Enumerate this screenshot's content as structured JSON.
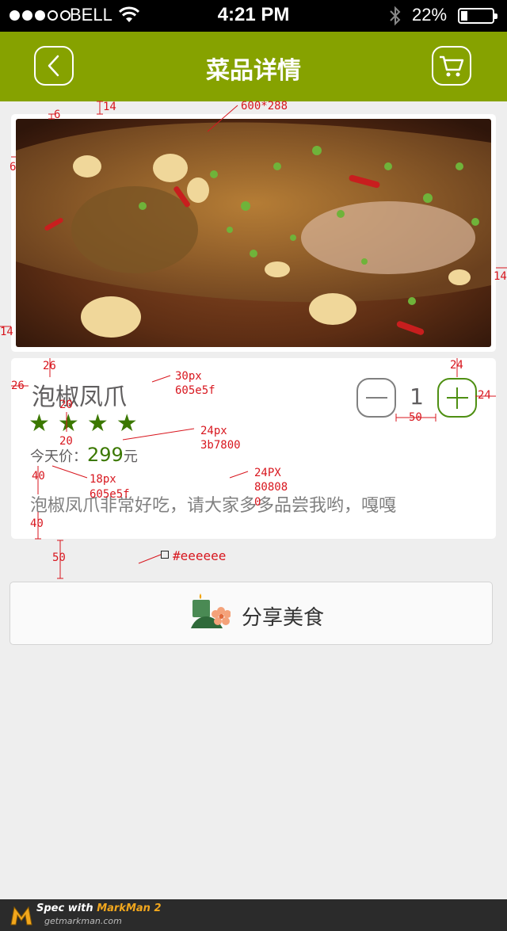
{
  "status_bar": {
    "carrier": "BELL",
    "time": "4:21 PM",
    "battery": "22%",
    "battery_level": 0.22,
    "signal_bars": 3,
    "signal_total": 5
  },
  "nav": {
    "title": "菜品详情",
    "back_icon": "chevron-left-icon",
    "cart_icon": "cart-icon"
  },
  "dish": {
    "name": "泡椒凤爪",
    "rating": 4,
    "star_glyph": "★",
    "price_label": "今天价：",
    "price": "299",
    "currency": "元",
    "description": "泡椒凤爪非常好吃，请大家多多品尝我哟，嘎嘎",
    "quantity": "1"
  },
  "share": {
    "label": "分享美食",
    "icon": "share-food-icon"
  },
  "annotations": {
    "top_gap": "14",
    "card_pad_top": "6",
    "card_pad_left": "6",
    "right_gap": "14",
    "left_gap": "14",
    "img_size": "600*288",
    "name_top": "26",
    "name_left": "26",
    "name_star_gap": "20",
    "star_price_gap": "20",
    "price_desc_gap": "40",
    "desc_bottom": "40",
    "card_share_gap": "50",
    "btn_top": "24",
    "btn_right": "24",
    "btn_width": "50",
    "name_font": "30px",
    "name_color": "605e5f",
    "star_font": "24px",
    "star_color": "3b7800",
    "price_font": "18px",
    "price_color": "605e5f",
    "desc_font": "24PX",
    "desc_color": "80808",
    "desc_color_tail": "0",
    "bg_color": "#eeeeee"
  },
  "footer": {
    "brand_prefix": "Spec with ",
    "brand": "MarkMan 2",
    "url": "getmarkman.com"
  }
}
